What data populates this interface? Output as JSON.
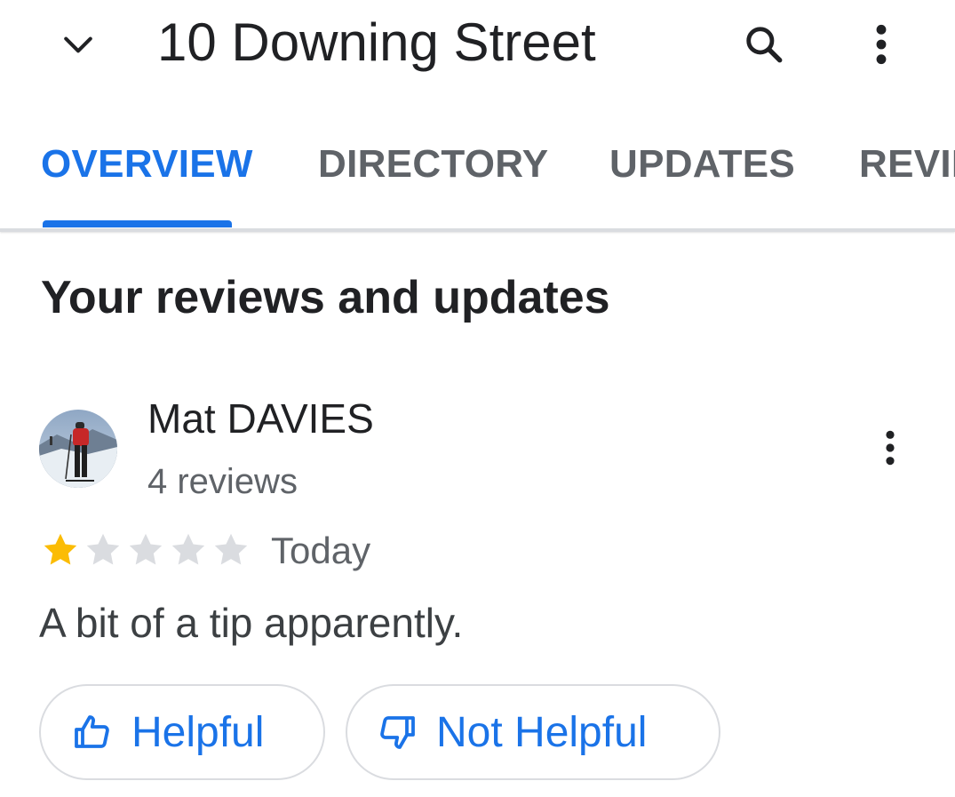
{
  "app_bar": {
    "title": "10 Downing Street",
    "back_icon": "chevron-down-icon",
    "search_icon": "search-icon",
    "more_icon": "more-vert-icon"
  },
  "tabs": [
    {
      "label": "OVERVIEW",
      "active": true
    },
    {
      "label": "DIRECTORY",
      "active": false
    },
    {
      "label": "UPDATES",
      "active": false
    },
    {
      "label": "REVIEWS",
      "active": false
    }
  ],
  "section": {
    "title": "Your reviews and updates"
  },
  "review": {
    "author": "Mat DAVIES",
    "author_meta": "4 reviews",
    "rating": 1,
    "rating_max": 5,
    "date": "Today",
    "text": "A bit of a tip apparently.",
    "actions": {
      "helpful_label": "Helpful",
      "not_helpful_label": "Not Helpful"
    }
  },
  "colors": {
    "accent": "#1a73e8",
    "star_filled": "#fbbc04",
    "star_empty": "#dadce0",
    "text_primary": "#202124",
    "text_secondary": "#5f6368"
  }
}
